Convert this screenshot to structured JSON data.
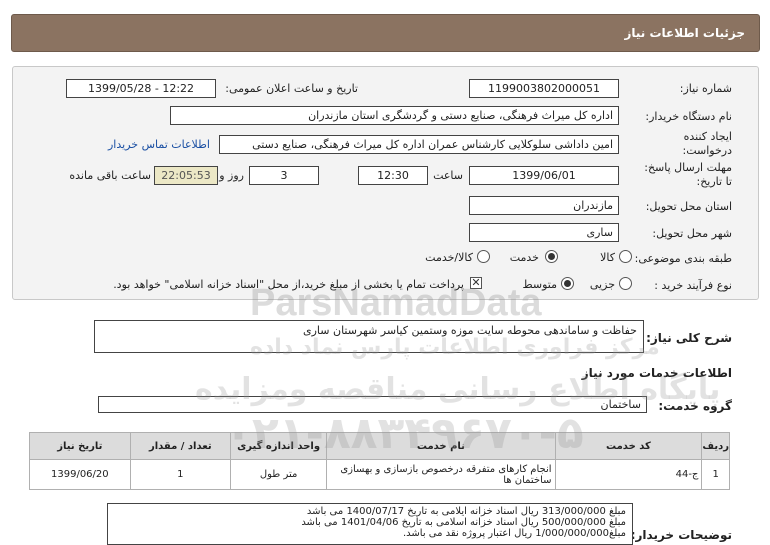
{
  "header": {
    "title": "جزئیات اطلاعات نیاز"
  },
  "fields": {
    "need_number_label": "شماره نیاز:",
    "need_number": "1199003802000051",
    "announce_label": "تاریخ و ساعت اعلان عمومی:",
    "announce_value": "1399/05/28 - 12:22",
    "buyer_label": "نام دستگاه خریدار:",
    "buyer_value": "اداره کل میراث فرهنگی، صنایع دستی و گردشگری استان مازندران",
    "creator_label_1": "ایجاد کننده",
    "creator_label_2": "درخواست:",
    "creator_value": "امین داداشی سلوکلایی کارشناس عمران اداره کل میراث فرهنگی، صنایع دستی",
    "contact_link": "اطلاعات تماس خریدار",
    "deadline_label_1": "مهلت ارسال پاسخ:",
    "deadline_label_2": "تا تاریخ:",
    "deadline_date": "1399/06/01",
    "time_label": "ساعت",
    "deadline_time": "12:30",
    "days_value": "3",
    "days_label": "روز و",
    "remaining_time": "22:05:53",
    "remaining_label": "ساعت باقی مانده",
    "province_label": "استان محل تحویل:",
    "province_value": "مازندران",
    "city_label": "شهر محل تحویل:",
    "city_value": "ساری",
    "category_label": "طبقه بندی موضوعی:",
    "category_options": [
      "کالا",
      "خدمت",
      "کالا/خدمت"
    ],
    "process_label": "نوع فرآیند خرید :",
    "process_options": [
      "جزیی",
      "متوسط"
    ],
    "payment_note": "پرداخت تمام یا بخشی از مبلغ خرید،از محل \"اسناد خزانه اسلامی\" خواهد بود."
  },
  "description": {
    "label": "شرح کلی نیاز:",
    "value": "حفاظت و ساماندهی محوطه سایت موزه وستمین کیاسر شهرستان ساری"
  },
  "services_section": {
    "title": "اطلاعات خدمات مورد نیاز"
  },
  "service_group": {
    "label": "گروه خدمت:",
    "value": "ساختمان"
  },
  "table": {
    "headers": [
      "ردیف",
      "کد خدمت",
      "نام خدمت",
      "واحد اندازه گیری",
      "تعداد / مقدار",
      "تاریخ نیاز"
    ],
    "rows": [
      [
        "1",
        "ج-44",
        "انجام کارهای متفرقه درخصوص بازسازی و بهسازی ساختمان ها",
        "متر طول",
        "1",
        "1399/06/20"
      ]
    ]
  },
  "notes": {
    "label": "توضیحات خریدار:",
    "lines": [
      "مبلغ 313/000/000 ریال اسناد خزانه ایلامی به تاریخ 1400/07/17 می باشد",
      "مبلغ 500/000/000 ریال اسناد خزانه اسلامی به تاریخ 1401/04/06 می باشد",
      "مبلغ1/000/000/000 ریال اعتبار پروژه نقد می باشد."
    ]
  },
  "watermark": {
    "brand": "ParsNamadData",
    "line1": "مرکز فراوری اطلاعات پارس نماد داده",
    "line2": "پایگاه اطلاع رسانی مناقصه ومزایده",
    "phone": "۰۲۱-۸۸۳۴۹۶۷۰-۵"
  }
}
